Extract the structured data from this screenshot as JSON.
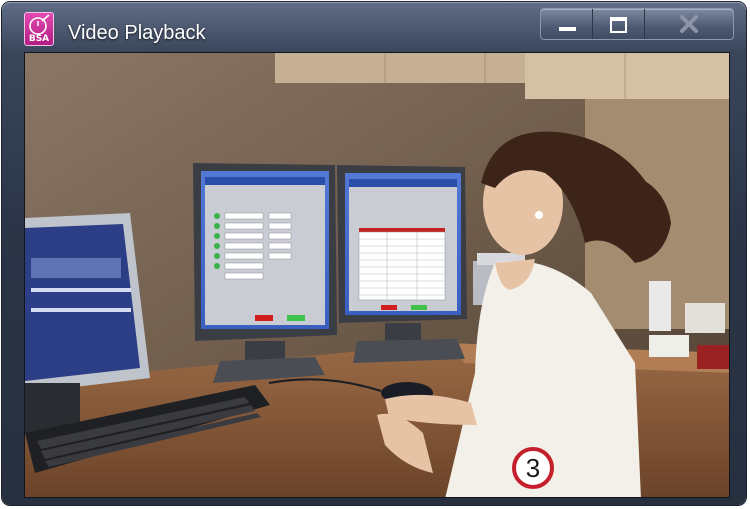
{
  "window": {
    "title": "Video Playback",
    "app_icon": {
      "name": "bsa-app-icon",
      "label": "BSA",
      "color": "#c62a97"
    },
    "controls": {
      "minimize": "minimize-icon",
      "maximize": "maximize-icon",
      "close": "close-icon"
    }
  },
  "video": {
    "step_marker": "3",
    "marker_color": "#c51f2b"
  }
}
